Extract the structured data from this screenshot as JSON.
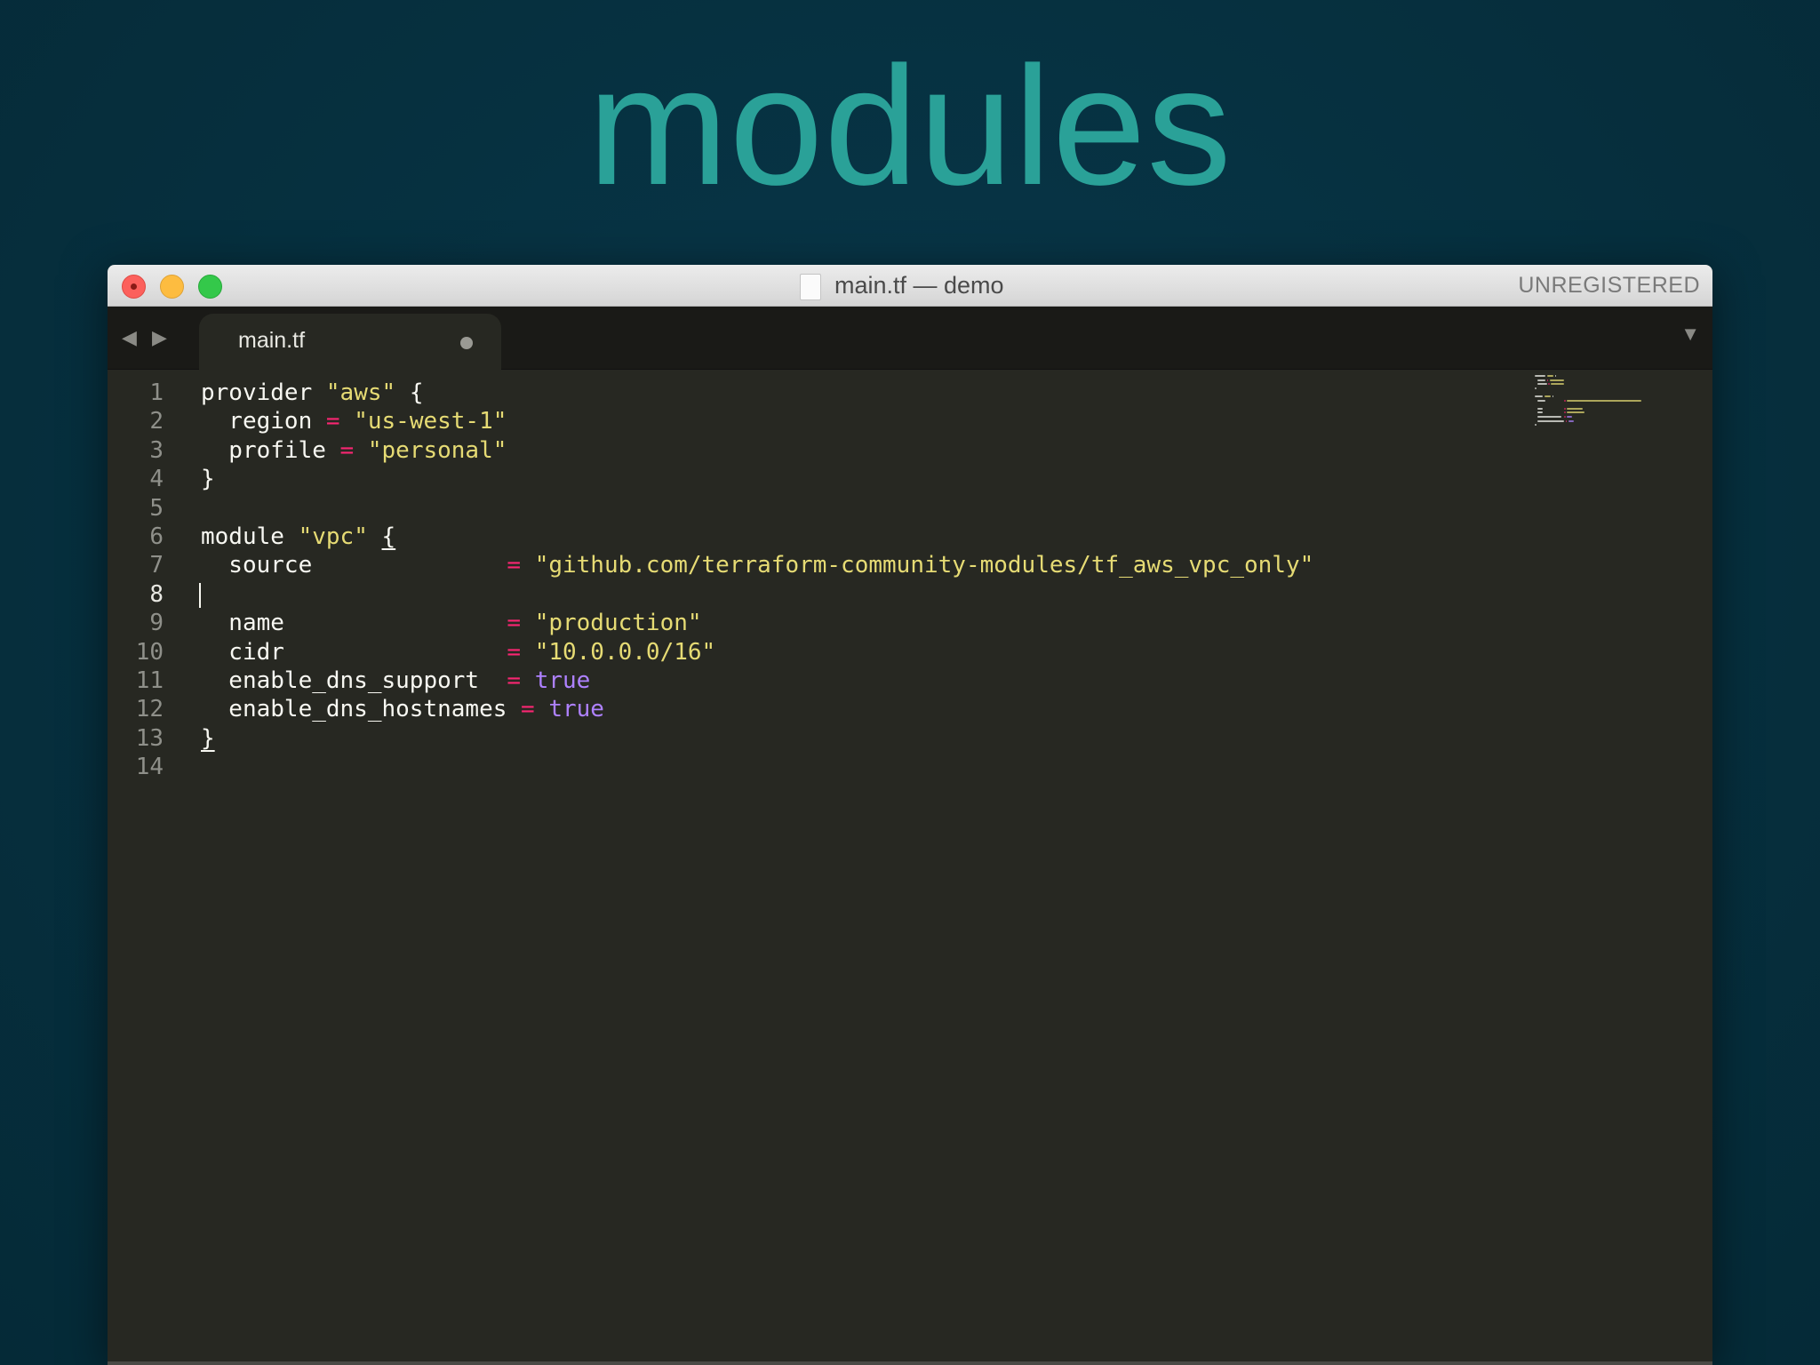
{
  "slide": {
    "title": "modules"
  },
  "window": {
    "title": "main.tf — demo",
    "license_status": "UNREGISTERED"
  },
  "tabbar": {
    "back_arrow": "◀",
    "forward_arrow": "▶",
    "menu_arrow": "▼",
    "tabs": [
      {
        "label": "main.tf",
        "modified": true
      }
    ]
  },
  "editor": {
    "active_line": 8,
    "lines": [
      {
        "num": "1",
        "tokens": [
          {
            "t": "provider ",
            "c": "plain"
          },
          {
            "t": "\"aws\"",
            "c": "str"
          },
          {
            "t": " {",
            "c": "plain"
          }
        ]
      },
      {
        "num": "2",
        "tokens": [
          {
            "t": "  region ",
            "c": "plain"
          },
          {
            "t": "=",
            "c": "op"
          },
          {
            "t": " ",
            "c": "plain"
          },
          {
            "t": "\"us-west-1\"",
            "c": "str"
          }
        ]
      },
      {
        "num": "3",
        "tokens": [
          {
            "t": "  profile ",
            "c": "plain"
          },
          {
            "t": "=",
            "c": "op"
          },
          {
            "t": " ",
            "c": "plain"
          },
          {
            "t": "\"personal\"",
            "c": "str"
          }
        ]
      },
      {
        "num": "4",
        "tokens": [
          {
            "t": "}",
            "c": "plain"
          }
        ]
      },
      {
        "num": "5",
        "tokens": []
      },
      {
        "num": "6",
        "tokens": [
          {
            "t": "module ",
            "c": "plain"
          },
          {
            "t": "\"vpc\"",
            "c": "str"
          },
          {
            "t": " ",
            "c": "plain"
          },
          {
            "t": "{",
            "c": "plain",
            "u": true
          }
        ]
      },
      {
        "num": "7",
        "tokens": [
          {
            "t": "  source              ",
            "c": "plain"
          },
          {
            "t": "=",
            "c": "op"
          },
          {
            "t": " ",
            "c": "plain"
          },
          {
            "t": "\"github.com/terraform-community-modules/tf_aws_vpc_only\"",
            "c": "str"
          }
        ]
      },
      {
        "num": "8",
        "tokens": []
      },
      {
        "num": "9",
        "tokens": [
          {
            "t": "  name                ",
            "c": "plain"
          },
          {
            "t": "=",
            "c": "op"
          },
          {
            "t": " ",
            "c": "plain"
          },
          {
            "t": "\"production\"",
            "c": "str"
          }
        ]
      },
      {
        "num": "10",
        "tokens": [
          {
            "t": "  cidr                ",
            "c": "plain"
          },
          {
            "t": "=",
            "c": "op"
          },
          {
            "t": " ",
            "c": "plain"
          },
          {
            "t": "\"10.0.0.0/16\"",
            "c": "str"
          }
        ]
      },
      {
        "num": "11",
        "tokens": [
          {
            "t": "  enable_dns_support  ",
            "c": "plain"
          },
          {
            "t": "=",
            "c": "op"
          },
          {
            "t": " ",
            "c": "plain"
          },
          {
            "t": "true",
            "c": "bool"
          }
        ]
      },
      {
        "num": "12",
        "tokens": [
          {
            "t": "  enable_dns_hostnames ",
            "c": "plain"
          },
          {
            "t": "=",
            "c": "op"
          },
          {
            "t": " ",
            "c": "plain"
          },
          {
            "t": "true",
            "c": "bool"
          }
        ]
      },
      {
        "num": "13",
        "tokens": [
          {
            "t": "}",
            "c": "plain",
            "u": true
          }
        ]
      },
      {
        "num": "14",
        "tokens": []
      }
    ]
  },
  "colors": {
    "title": "#2aa198",
    "editor_bg": "#272822",
    "string": "#e6db74",
    "operator": "#f92672",
    "boolean": "#ae81ff",
    "text": "#f8f8f2"
  }
}
